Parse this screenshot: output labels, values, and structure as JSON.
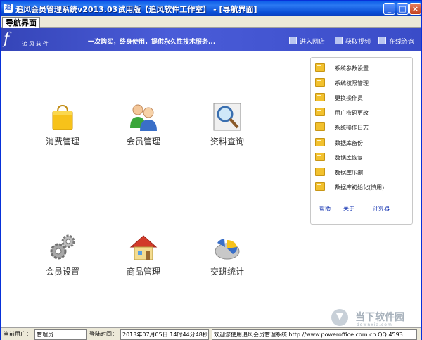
{
  "window": {
    "title": "追风会员管理系统v2013.03试用版【追风软件工作室】 - [导航界面]",
    "app_icon": "追"
  },
  "title_buttons": {
    "minimize": "_",
    "maximize": "□",
    "close": "×"
  },
  "tab": {
    "label": "导航界面"
  },
  "banner": {
    "logo_text": "追风软件",
    "logo_mark": "f",
    "slogan": "一次购买，终身使用，提供永久性技术服务...",
    "links": [
      "进入网店",
      "获取视频",
      "在线咨询"
    ]
  },
  "tiles": [
    {
      "label": "消费管理",
      "icon": "shopping-bag-icon"
    },
    {
      "label": "会员管理",
      "icon": "members-icon"
    },
    {
      "label": "资料查询",
      "icon": "magnifier-icon"
    },
    {
      "label": "会员设置",
      "icon": "gears-icon"
    },
    {
      "label": "商品管理",
      "icon": "house-icon"
    },
    {
      "label": "交班统计",
      "icon": "pie-chart-icon"
    }
  ],
  "panel": {
    "items": [
      "系统参数设置",
      "系统权限管理",
      "更换操作员",
      "用户密码更改",
      "系统操作日志",
      "数据库备份",
      "数据库恢复",
      "数据库压缩",
      "数据库初始化(慎用)"
    ],
    "links": [
      "帮助",
      "关于",
      "计算器"
    ]
  },
  "statusbar": {
    "user_label": "当前用户：",
    "user_value": "管理员",
    "login_label": "登陆时间：",
    "login_value": "2013年07月05日 14时44分48秒",
    "message": "欢迎您使用追风会员管理系统 http://www.poweroffice.com.cn QQ:4593"
  },
  "watermark": {
    "text": "当下软件园",
    "sub": "downxia.com"
  },
  "colors": {
    "title_bar": "#0a5ce8",
    "banner": "#4a5cd8",
    "link": "#1030b0"
  }
}
